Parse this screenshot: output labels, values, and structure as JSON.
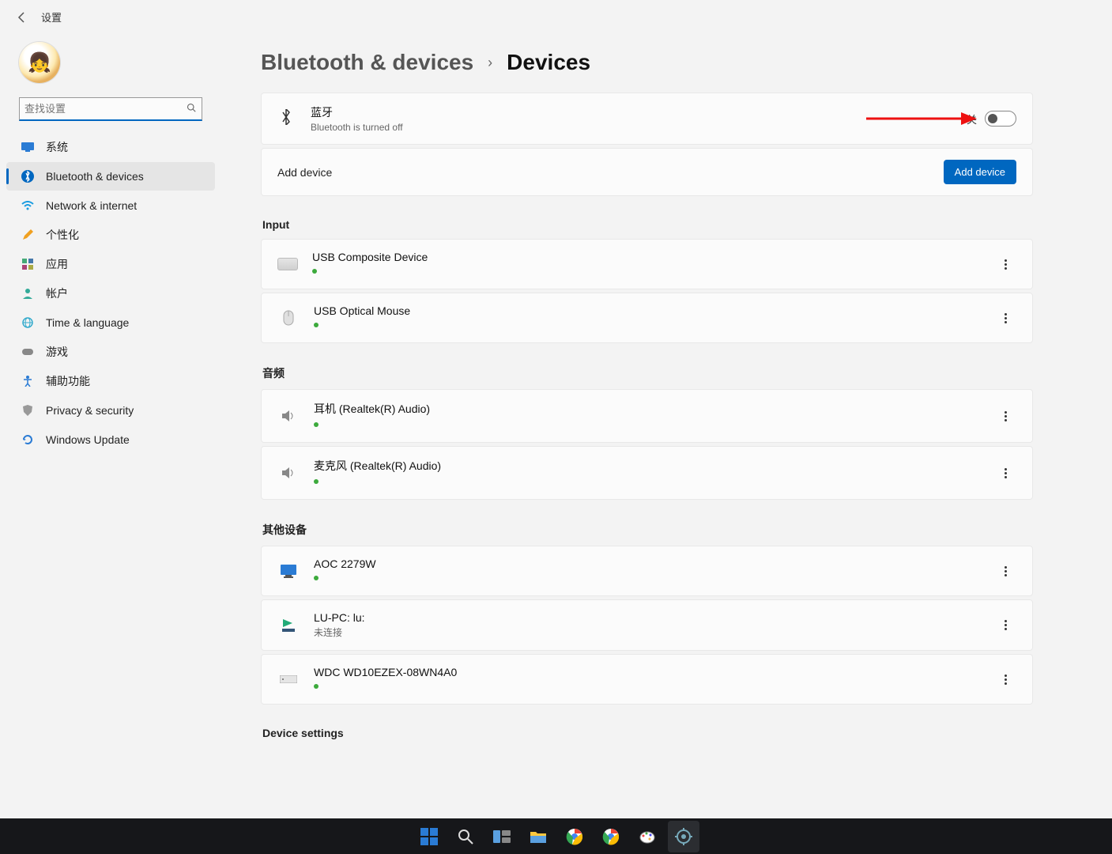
{
  "header": {
    "title": "设置"
  },
  "search": {
    "placeholder": "查找设置"
  },
  "nav": {
    "items": [
      {
        "label": "系统"
      },
      {
        "label": "Bluetooth & devices"
      },
      {
        "label": "Network & internet"
      },
      {
        "label": "个性化"
      },
      {
        "label": "应用"
      },
      {
        "label": "帐户"
      },
      {
        "label": "Time & language"
      },
      {
        "label": "游戏"
      },
      {
        "label": "辅助功能"
      },
      {
        "label": "Privacy & security"
      },
      {
        "label": "Windows Update"
      }
    ],
    "active_index": 1
  },
  "breadcrumb": {
    "parent": "Bluetooth & devices",
    "current": "Devices"
  },
  "bluetooth": {
    "title": "蓝牙",
    "subtitle": "Bluetooth is turned off",
    "state_label": "关",
    "on": false
  },
  "add_device": {
    "label": "Add device",
    "button": "Add device"
  },
  "sections": {
    "input": {
      "title": "Input",
      "devices": [
        {
          "name": "USB Composite Device",
          "status": "connected"
        },
        {
          "name": "USB Optical Mouse",
          "status": "connected"
        }
      ]
    },
    "audio": {
      "title": "音频",
      "devices": [
        {
          "name": "耳机 (Realtek(R) Audio)",
          "status": "connected"
        },
        {
          "name": "麦克风 (Realtek(R) Audio)",
          "status": "connected"
        }
      ]
    },
    "other": {
      "title": "其他设备",
      "devices": [
        {
          "name": "AOC 2279W",
          "status": "connected"
        },
        {
          "name": "LU-PC: lu:",
          "status_text": "未连接"
        },
        {
          "name": "WDC WD10EZEX-08WN4A0",
          "status": "connected"
        }
      ]
    },
    "device_settings": {
      "title": "Device settings"
    }
  },
  "annotation": {
    "color": "#e11",
    "direction": "right"
  }
}
